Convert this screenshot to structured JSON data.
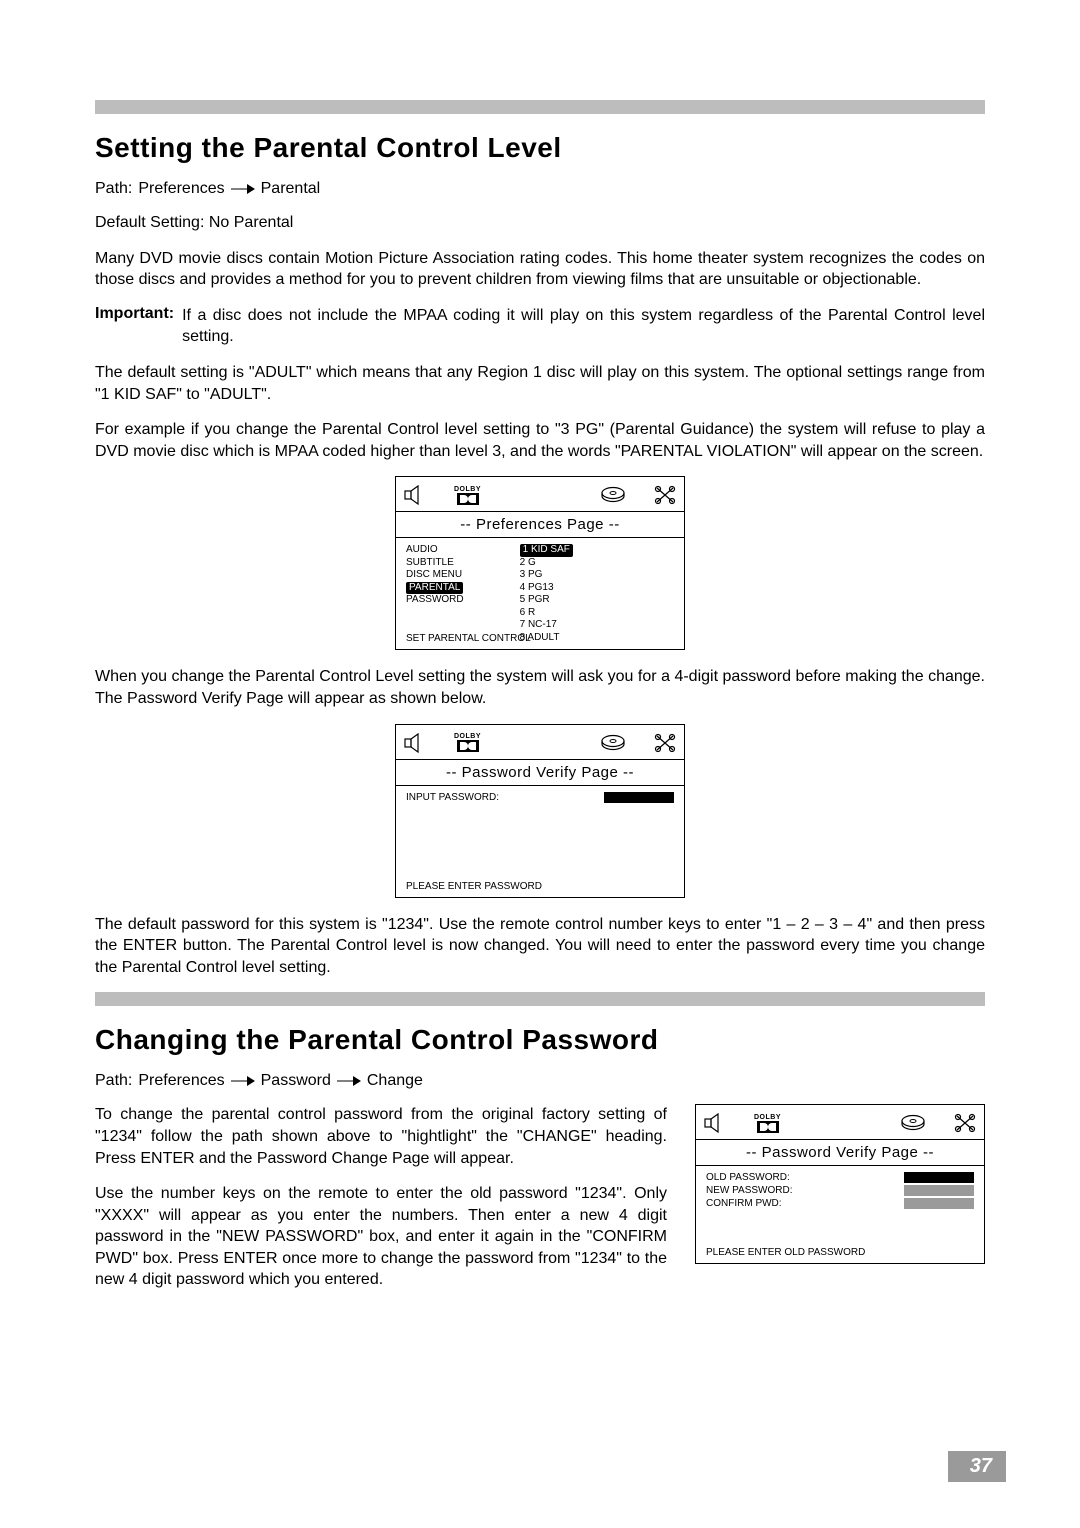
{
  "section1": {
    "heading": "Setting the Parental Control Level",
    "path_label": "Path:",
    "path_parts": [
      "Preferences",
      "Parental"
    ],
    "default_setting": "Default Setting: No Parental",
    "para1": "Many DVD movie discs contain Motion Picture Association rating codes. This home theater system recognizes the codes on those discs and provides a method for you to prevent children from viewing films that are unsuitable or objectionable.",
    "important_label": "Important:",
    "important_text": "If a disc does not include the MPAA coding it will play on this system regardless of the Parental Control level setting.",
    "para2": "The default setting is \"ADULT\" which means that any Region 1 disc will play on this system. The optional settings range from \"1 KID SAF\" to \"ADULT\".",
    "para3": "For example if you change the Parental Control level setting to \"3 PG\" (Parental Guidance) the system will refuse to play a DVD movie disc which is MPAA coded higher than level 3, and the words \"PARENTAL VIOLATION\" will appear on the screen.",
    "para4": "When you change the Parental Control Level setting the system will ask you for a 4-digit password before making the change. The Password Verify Page will appear as shown below.",
    "para5": "The default password for this system is \"1234\". Use the remote control number keys to enter \"1 – 2 – 3 – 4\" and then press the ENTER button. The Parental Control level is now changed. You will need to enter the password every time you change the Parental Control level setting."
  },
  "osd_common": {
    "dolby": "DOLBY"
  },
  "osd1": {
    "title": "--  Preferences  Page  --",
    "left_items": [
      "AUDIO",
      "SUBTITLE",
      "DISC MENU",
      "PARENTAL",
      "PASSWORD"
    ],
    "highlighted_left_index": 3,
    "right_items": [
      "1 KID SAF",
      "2 G",
      "3 PG",
      "4 PG13",
      "5 PGR",
      "6 R",
      "7 NC-17",
      "8 ADULT"
    ],
    "highlighted_right_index": 0,
    "footer": "SET PARENTAL CONTROL"
  },
  "osd2": {
    "title": "--  Password  Verify  Page  --",
    "input_label": "INPUT PASSWORD:",
    "footer": "PLEASE ENTER PASSWORD"
  },
  "section2": {
    "heading": "Changing the Parental Control Password",
    "path_label": "Path:",
    "path_parts": [
      "Preferences",
      "Password",
      "Change"
    ],
    "para1": "To change the parental control password from the original factory setting of \"1234\" follow the path shown above to \"hightlight\" the \"CHANGE\" heading. Press ENTER and the Password Change Page will appear.",
    "para2": "Use the number keys on the remote to enter the old password \"1234\". Only \"XXXX\" will appear as you enter the numbers. Then enter a new 4 digit password in the \"NEW PASSWORD\" box, and enter it again in the \"CONFIRM PWD\" box. Press ENTER once more to change the password from \"1234\" to the new 4 digit password which you entered."
  },
  "osd3": {
    "title": "--  Password  Verify  Page  --",
    "rows": [
      {
        "label": "OLD PASSWORD:",
        "box": "black"
      },
      {
        "label": "NEW PASSWORD:",
        "box": "grey"
      },
      {
        "label": "CONFIRM PWD:",
        "box": "grey"
      }
    ],
    "footer": "PLEASE ENTER OLD PASSWORD"
  },
  "page_number": "37"
}
